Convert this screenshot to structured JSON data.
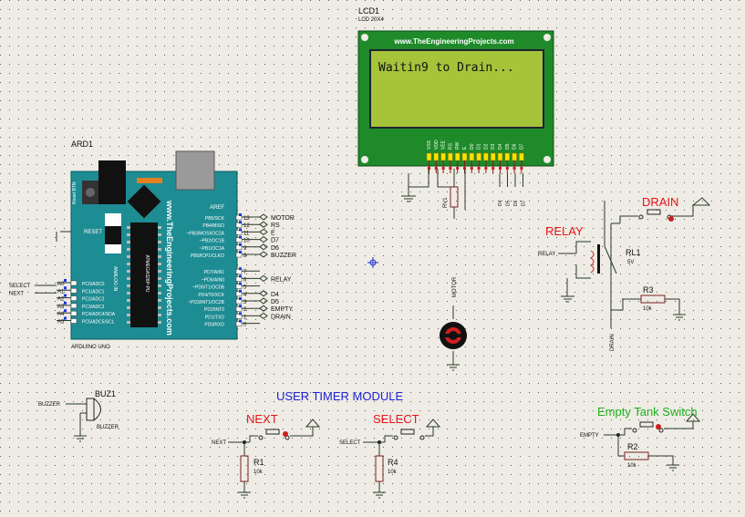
{
  "lcd": {
    "ref": "LCD1",
    "model": "LCD 20X4",
    "header": "www.TheEngineeringProjects.com",
    "display_text": "Waitin9 to Drain...",
    "pins": [
      "VSS",
      "VDD",
      "VEE",
      "RS",
      "RW",
      "E",
      "D0",
      "D1",
      "D2",
      "D3",
      "D4",
      "D5",
      "D6",
      "D7"
    ],
    "lower_pins": [
      "D4",
      "D5",
      "D6",
      "D7"
    ],
    "res_label": "RV1"
  },
  "arduino": {
    "ref": "ARD1",
    "model": "ARDUINO UNO",
    "brand": "www.TheEngineeringProjects.com",
    "reset_btn": "Reset BTN",
    "reset_label": "RESET",
    "aref": "AREF",
    "analog_in": "ANALOG IN",
    "chip": "ATMEGA328P-PU",
    "digital_pins": [
      "PB5/SCK",
      "PB4/MISO",
      "~PB3/MOSI/OC2A",
      "~PB2/OC1B",
      "~PB1/OC1A",
      "PB0/ICP1/CLKO",
      "PD7/AIN1",
      "~PD6/AIN0",
      "~PD5/T1/OC0B",
      "PD4/T0/XCK",
      "~PD3/INT1/OC2B",
      "PD2/INT0",
      "PD1/TXD",
      "PD0/RXD"
    ],
    "digital_numbers": [
      "13",
      "12",
      "11",
      "10",
      "9",
      "8",
      "7",
      "6",
      "5",
      "4",
      "3",
      "2",
      "1",
      "0"
    ],
    "analog_pins": [
      "PC0/ADC0",
      "PC1/ADC1",
      "PC2/ADC2",
      "PC3/ADC3",
      "PC4/ADC4/SDA",
      "PC5/ADC5/SCL"
    ],
    "analog_numbers": [
      "A0",
      "A1",
      "A2",
      "A3",
      "A4",
      "A5"
    ]
  },
  "net_labels": {
    "digital": [
      "MOTOR",
      "RS",
      "E",
      "D7",
      "D6",
      "BUZZER",
      "",
      "RELAY",
      "",
      "D4",
      "D5",
      "EMPTY",
      "DRAIN",
      ""
    ],
    "analog_left": [
      "SELECT",
      "NEXT"
    ],
    "motor": "MOTOR",
    "relay_in": "RELAY",
    "drain_out": "DRAIN",
    "buzzer_in": "BUZZER",
    "next_in": "NEXT",
    "select_in": "SELECT",
    "empty_in": "EMPTY"
  },
  "titles": {
    "drain": "DRAIN",
    "relay": "RELAY",
    "user_timer": "USER TIMER MODULE",
    "next": "NEXT",
    "select": "SELECT",
    "empty_tank": "Empty Tank Switch"
  },
  "components": {
    "relay": {
      "ref": "RL1",
      "value": "5V"
    },
    "r3": {
      "ref": "R3",
      "value": "10k"
    },
    "buzzer": {
      "ref": "BUZ1",
      "value": "BUZZER"
    },
    "r1": {
      "ref": "R1",
      "value": "10k"
    },
    "r4": {
      "ref": "R4",
      "value": "10k"
    },
    "r2": {
      "ref": "R2",
      "value": "10k"
    }
  },
  "colors": {
    "background": "#eeece4",
    "board": "#1e8c93",
    "lcd_pcb": "#1f8a2a",
    "lcd_screen": "#a6c43a",
    "net_wire": "#2a3a2a",
    "title_red": "#e8141b",
    "title_blue": "#1c22d6",
    "title_green": "#20b020"
  }
}
